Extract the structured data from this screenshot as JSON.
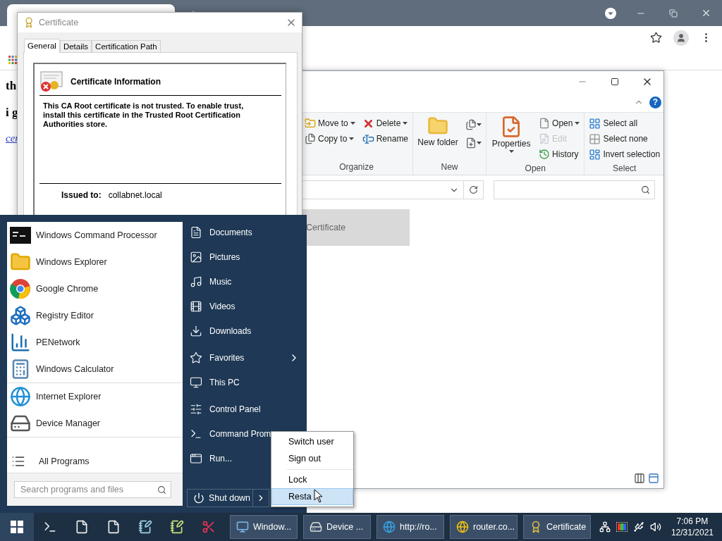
{
  "browser": {
    "page_text": [
      {
        "kind": "bold",
        "text": "th"
      },
      {
        "kind": "bold",
        "text": "i g"
      },
      {
        "kind": "link",
        "text": "cer"
      }
    ]
  },
  "explorer": {
    "ribbon": [
      {
        "label": "Organize",
        "columns": [
          [
            {
              "kind": "small",
              "label": "Move to",
              "dropdown": true,
              "disabled": false
            },
            {
              "kind": "small",
              "label": "Copy to",
              "dropdown": true,
              "disabled": false
            }
          ],
          [
            {
              "kind": "small",
              "label": "Delete",
              "dropdown": true,
              "disabled": false
            },
            {
              "kind": "small",
              "label": "Rename",
              "dropdown": false,
              "disabled": false
            }
          ]
        ]
      },
      {
        "label": "New",
        "columns": [
          [
            {
              "kind": "large",
              "label": "New folder",
              "dropdown": false,
              "disabled": false
            }
          ],
          [
            {
              "kind": "icon",
              "dropdown": true,
              "disabled": false
            },
            {
              "kind": "icon",
              "dropdown": true,
              "disabled": false
            }
          ]
        ]
      },
      {
        "label": "Open",
        "columns": [
          [
            {
              "kind": "large",
              "label": "Properties",
              "dropdown": true,
              "disabled": false
            }
          ],
          [
            {
              "kind": "small",
              "label": "Open",
              "dropdown": true,
              "disabled": false
            },
            {
              "kind": "small",
              "label": "Edit",
              "dropdown": false,
              "disabled": true
            },
            {
              "kind": "small",
              "label": "History",
              "dropdown": false,
              "disabled": false
            }
          ]
        ]
      },
      {
        "label": "Select",
        "columns": [
          [
            {
              "kind": "small",
              "label": "Select all",
              "dropdown": false,
              "disabled": false
            },
            {
              "kind": "small",
              "label": "Select none",
              "dropdown": false,
              "disabled": false
            },
            {
              "kind": "small",
              "label": "Invert selection",
              "dropdown": false,
              "disabled": false
            }
          ]
        ]
      }
    ],
    "files": [
      {
        "name": "Certificate",
        "selected": true
      }
    ],
    "help": "?"
  },
  "certificate_dialog": {
    "title": "Certificate",
    "tabs": [
      {
        "label": "General",
        "selected": true
      },
      {
        "label": "Details",
        "selected": false
      },
      {
        "label": "Certification Path",
        "selected": false
      }
    ],
    "heading": "Certificate Information",
    "message": "This CA Root certificate is not trusted. To enable trust, install this certificate in the Trusted Root Certification Authorities store.",
    "issued_to_label": "Issued to:",
    "issued_to": "collabnet.local"
  },
  "start_menu": {
    "program_groups": [
      [
        "Windows Command Processor",
        "Windows Explorer",
        "Google Chrome",
        "Registry Editor",
        "PENetwork",
        "Windows Calculator"
      ],
      [
        "Internet Explorer",
        "Device Manager"
      ]
    ],
    "all_programs": "All Programs",
    "search": {
      "placeholder": "Search programs and files"
    },
    "place_groups": [
      [
        {
          "label": "Documents",
          "kind": "link"
        },
        {
          "label": "Pictures",
          "kind": "link"
        },
        {
          "label": "Music",
          "kind": "link"
        },
        {
          "label": "Videos",
          "kind": "link"
        },
        {
          "label": "Downloads",
          "kind": "link"
        }
      ],
      [
        {
          "label": "Favorites",
          "kind": "submenu"
        },
        {
          "label": "This PC",
          "kind": "link"
        }
      ],
      [
        {
          "label": "Control Panel",
          "kind": "link"
        },
        {
          "label": "Command Prom",
          "kind": "link"
        },
        {
          "label": "Run...",
          "kind": "link"
        }
      ]
    ],
    "shutdown": "Shut down"
  },
  "power_menu": {
    "sections": [
      [
        {
          "label": "Switch user",
          "selected": false
        },
        {
          "label": "Sign out",
          "selected": false
        }
      ],
      [
        {
          "label": "Lock",
          "selected": false
        },
        {
          "label": "Resta",
          "selected": true
        }
      ]
    ]
  },
  "taskbar": {
    "tasks": [
      "Window...",
      "Device ...",
      "http://ro...",
      "router.co...",
      "Certificate"
    ],
    "time": "7:06 PM",
    "date": "12/31/2021"
  }
}
